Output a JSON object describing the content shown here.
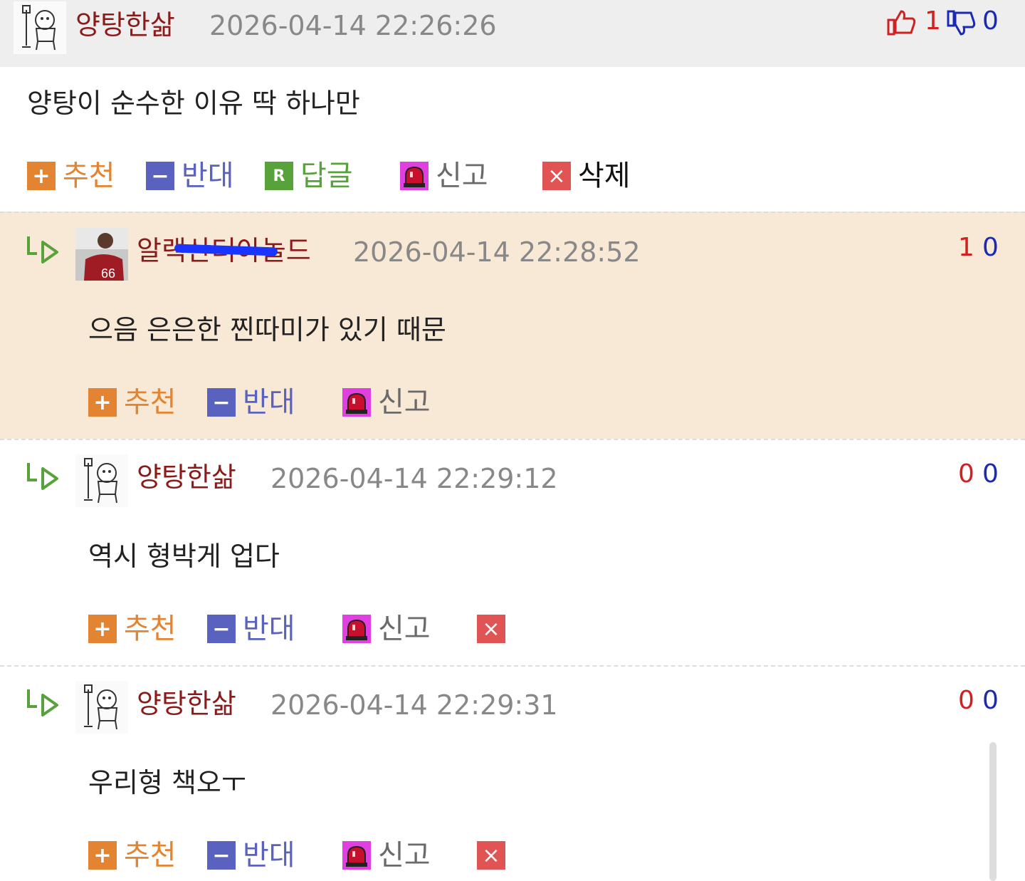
{
  "main_comment": {
    "nickname": "양탕한삶",
    "timestamp": "2026-04-14 22:26:26",
    "text": "양탕이 순수한 이유 딱 하나만",
    "upvotes": "1",
    "downvotes": "0",
    "actions": {
      "recommend": "추천",
      "oppose": "반대",
      "reply_icon": "R",
      "reply": "답글",
      "report": "신고",
      "delete": "삭제"
    }
  },
  "replies": [
    {
      "nickname": "알랙산더아놀드",
      "timestamp": "2026-04-14 22:28:52",
      "text": "으음 은은한 찐따미가 있기 때문",
      "upvotes": "1",
      "downvotes": "0",
      "actions": {
        "recommend": "추천",
        "oppose": "반대",
        "report": "신고"
      }
    },
    {
      "nickname": "양탕한삶",
      "timestamp": "2026-04-14 22:29:12",
      "text": "역시 형박게 업다",
      "upvotes": "0",
      "downvotes": "0",
      "actions": {
        "recommend": "추천",
        "oppose": "반대",
        "report": "신고"
      }
    },
    {
      "nickname": "양탕한삶",
      "timestamp": "2026-04-14 22:29:31",
      "text": "우리형 책오ㅜ",
      "upvotes": "0",
      "downvotes": "0",
      "actions": {
        "recommend": "추천",
        "oppose": "반대",
        "report": "신고"
      }
    }
  ],
  "icons": {
    "plus": "+",
    "minus": "−",
    "delete": "×"
  },
  "colors": {
    "nickname": "#8b1a1a",
    "upvote": "#d02020",
    "downvote": "#1a2ab5",
    "highlight_bg": "#f8e8d6"
  }
}
